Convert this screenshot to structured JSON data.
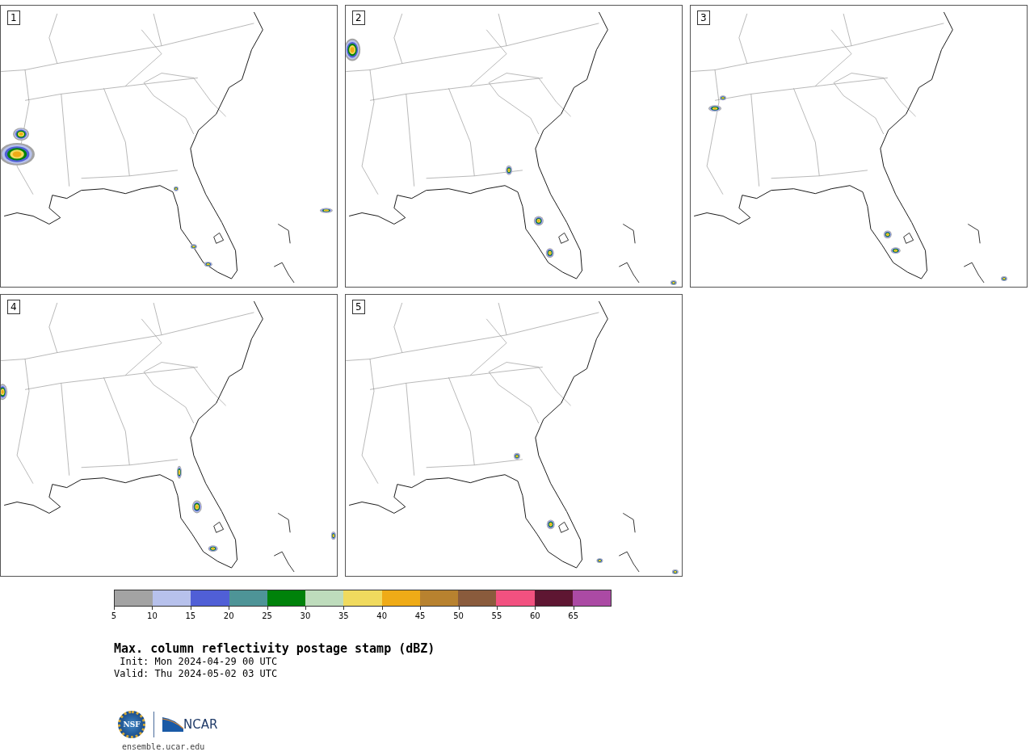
{
  "panels": [
    {
      "label": "1"
    },
    {
      "label": "2"
    },
    {
      "label": "3"
    },
    {
      "label": "4"
    },
    {
      "label": "5"
    }
  ],
  "colorbar": {
    "bins": [
      {
        "color": "#a3a3a3",
        "label": "5"
      },
      {
        "color": "#b7c1ec",
        "label": "10"
      },
      {
        "color": "#505fd6",
        "label": "15"
      },
      {
        "color": "#4e9497",
        "label": "20"
      },
      {
        "color": "#00820a",
        "label": "25"
      },
      {
        "color": "#bedcbc",
        "label": "30"
      },
      {
        "color": "#f0da5e",
        "label": "35"
      },
      {
        "color": "#efab17",
        "label": "40"
      },
      {
        "color": "#b8822f",
        "label": "45"
      },
      {
        "color": "#8a5b3c",
        "label": "50"
      },
      {
        "color": "#f25180",
        "label": "55"
      },
      {
        "color": "#5e1632",
        "label": "60"
      },
      {
        "color": "#ab4aa4",
        "label": "65"
      }
    ]
  },
  "title": "Max. column reflectivity postage stamp (dBZ)",
  "init": " Init: Mon 2024-04-29 00 UTC",
  "valid": "Valid: Thu 2024-05-02 03 UTC",
  "logo": {
    "nsf": "NSF",
    "ncar": "NCAR"
  },
  "url": "ensemble.ucar.edu"
}
